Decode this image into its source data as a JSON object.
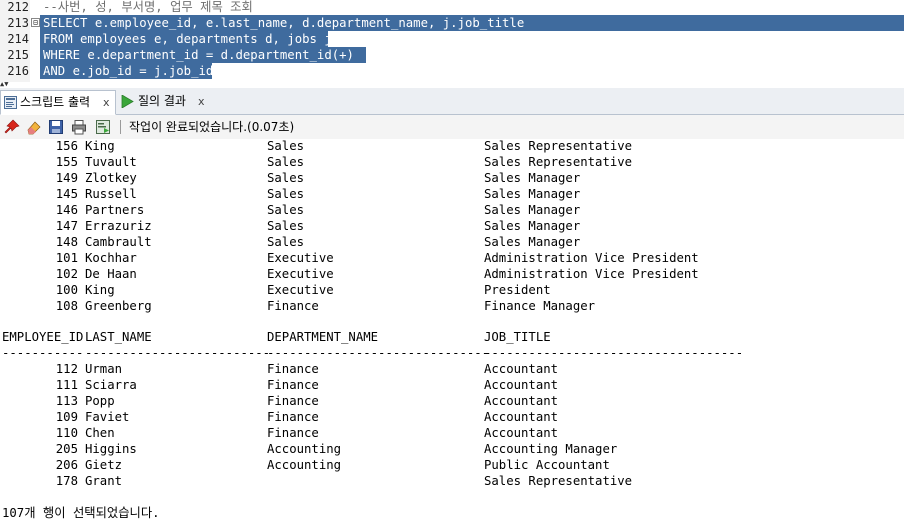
{
  "editor": {
    "lines": [
      {
        "num": "212",
        "text": "--사번, 성, 부서명, 업무 제목 조회",
        "selected": false,
        "comment": true
      },
      {
        "num": "213",
        "text": "SELECT e.employee_id, e.last_name, d.department_name, j.job_title",
        "selected": true,
        "comment": false
      },
      {
        "num": "214",
        "text": "FROM employees e, departments d, jobs j",
        "selected": true,
        "comment": false
      },
      {
        "num": "215",
        "text": "WHERE e.department_id = d.department_id(+)",
        "selected": true,
        "comment": false
      },
      {
        "num": "216",
        "text": "AND e.job_id = j.job_id;",
        "selected": true,
        "comment": false
      }
    ],
    "fold_marker": "⊟"
  },
  "tabs": [
    {
      "label": "스크립트 출력",
      "close": "x",
      "icon": "script-output-icon",
      "active": true
    },
    {
      "label": "질의 결과",
      "close": "x",
      "icon": "run-arrow-icon",
      "active": false
    }
  ],
  "toolbar": {
    "icons": [
      "pin-icon",
      "eraser-icon",
      "save-icon",
      "print-icon",
      "output-file-icon"
    ],
    "status": "작업이 완료되었습니다.(0.07초)"
  },
  "output": {
    "rows_top": [
      {
        "id": "156",
        "last": "King",
        "dept": "Sales",
        "job": "Sales Representative"
      },
      {
        "id": "155",
        "last": "Tuvault",
        "dept": "Sales",
        "job": "Sales Representative"
      },
      {
        "id": "149",
        "last": "Zlotkey",
        "dept": "Sales",
        "job": "Sales Manager"
      },
      {
        "id": "145",
        "last": "Russell",
        "dept": "Sales",
        "job": "Sales Manager"
      },
      {
        "id": "146",
        "last": "Partners",
        "dept": "Sales",
        "job": "Sales Manager"
      },
      {
        "id": "147",
        "last": "Errazuriz",
        "dept": "Sales",
        "job": "Sales Manager"
      },
      {
        "id": "148",
        "last": "Cambrault",
        "dept": "Sales",
        "job": "Sales Manager"
      },
      {
        "id": "101",
        "last": "Kochhar",
        "dept": "Executive",
        "job": "Administration Vice President"
      },
      {
        "id": "102",
        "last": "De Haan",
        "dept": "Executive",
        "job": "Administration Vice President"
      },
      {
        "id": "100",
        "last": "King",
        "dept": "Executive",
        "job": "President"
      },
      {
        "id": "108",
        "last": "Greenberg",
        "dept": "Finance",
        "job": "Finance Manager"
      }
    ],
    "headers": {
      "id": "EMPLOYEE_ID",
      "last": "LAST_NAME",
      "dept": "DEPARTMENT_NAME",
      "job": "JOB_TITLE"
    },
    "dashes": {
      "id": "-----------",
      "last": "-------------------------",
      "dept": "------------------------------",
      "job": "-----------------------------------"
    },
    "rows_bottom": [
      {
        "id": "112",
        "last": "Urman",
        "dept": "Finance",
        "job": "Accountant"
      },
      {
        "id": "111",
        "last": "Sciarra",
        "dept": "Finance",
        "job": "Accountant"
      },
      {
        "id": "113",
        "last": "Popp",
        "dept": "Finance",
        "job": "Accountant"
      },
      {
        "id": "109",
        "last": "Faviet",
        "dept": "Finance",
        "job": "Accountant"
      },
      {
        "id": "110",
        "last": "Chen",
        "dept": "Finance",
        "job": "Accountant"
      },
      {
        "id": "205",
        "last": "Higgins",
        "dept": "Accounting",
        "job": "Accounting Manager"
      },
      {
        "id": "206",
        "last": "Gietz",
        "dept": "Accounting",
        "job": "Public Accountant"
      },
      {
        "id": "178",
        "last": "Grant",
        "dept": "",
        "job": "Sales Representative"
      }
    ],
    "summary": "107개 행이 선택되었습니다."
  },
  "colors": {
    "selection": "#3f6b9e",
    "tab_border": "#b8c2cf"
  }
}
